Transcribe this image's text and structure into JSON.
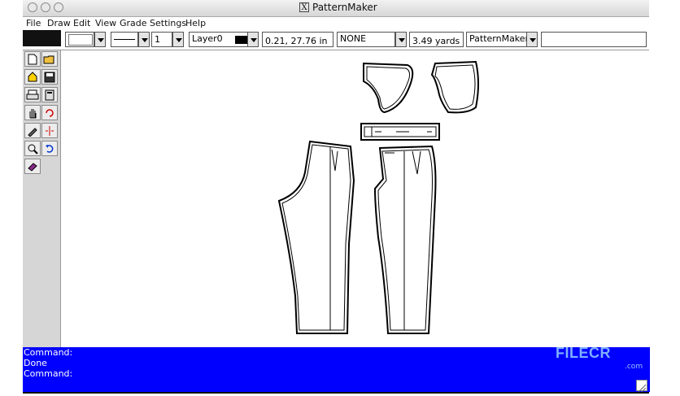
{
  "window": {
    "title": "PatternMaker"
  },
  "menu": {
    "file": "File",
    "draw": "Draw",
    "edit": "Edit",
    "view": "View",
    "grade": "Grade",
    "settings": "Settings",
    "help": "Help"
  },
  "toolbar": {
    "line_width_value": "1",
    "layer_value": "Layer0",
    "coordinates": "0.21, 27.76 in",
    "grade_value": "NONE",
    "yardage": "3.49 yards",
    "app_select_value": "PatternMaker",
    "command_input_value": ""
  },
  "console": {
    "lines": [
      "Command:",
      "Done",
      "Command:"
    ]
  },
  "watermark": {
    "brand": "FILECR",
    "sub": ".com"
  },
  "colors": {
    "console_bg": "#0000ff",
    "console_text": "#ffffff"
  }
}
